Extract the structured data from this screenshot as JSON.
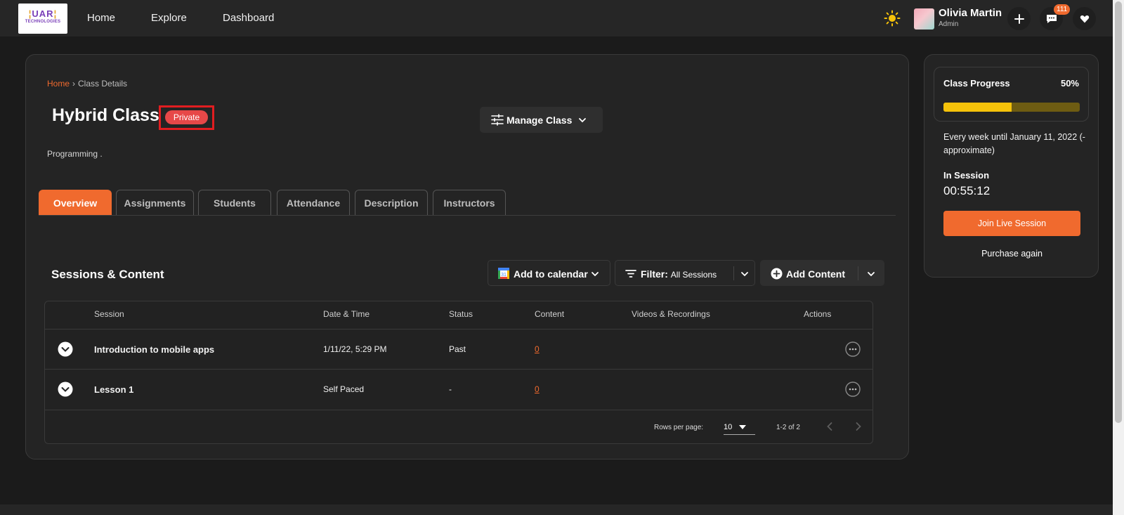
{
  "logo": {
    "line1": "UAR",
    "line2": "TECHNOLOGIES"
  },
  "nav": {
    "home": "Home",
    "explore": "Explore",
    "dashboard": "Dashboard"
  },
  "user": {
    "name": "Olivia Martin",
    "role": "Admin",
    "notifications": "111"
  },
  "breadcrumb": {
    "home": "Home",
    "separator": "›",
    "current": "Class Details"
  },
  "class": {
    "title": "Hybrid Class",
    "visibility": "Private",
    "subject": "Programming ."
  },
  "manage": {
    "label": "Manage Class"
  },
  "tabs": [
    "Overview",
    "Assignments",
    "Students",
    "Attendance",
    "Description",
    "Instructors"
  ],
  "sessions": {
    "title": "Sessions & Content",
    "add_calendar": "Add to calendar",
    "filter_label": "Filter:",
    "filter_value": "All Sessions",
    "add_content": "Add Content",
    "columns": [
      "Session",
      "Date & Time",
      "Status",
      "Content",
      "Videos & Recordings",
      "Actions"
    ],
    "rows": [
      {
        "session": "Introduction to mobile apps",
        "datetime": "1/11/22, 5:29 PM",
        "status": "Past",
        "content": "0"
      },
      {
        "session": "Lesson 1",
        "datetime": "Self Paced",
        "status": "-",
        "content": "0"
      }
    ],
    "rows_per_page_label": "Rows per page:",
    "rows_per_page": "10",
    "range": "1-2 of 2"
  },
  "progress": {
    "title": "Class Progress",
    "percent_label": "50%",
    "percent": 50,
    "schedule": "Every week until January 11, 2022 (-approximate)",
    "session_label": "In Session",
    "timer": "00:55:12",
    "join": "Join Live Session",
    "purchase": "Purchase again"
  },
  "colors": {
    "accent": "#f06a2e",
    "badge": "#e74848",
    "highlight": "#e11d20",
    "progress": "#f5c20a"
  }
}
